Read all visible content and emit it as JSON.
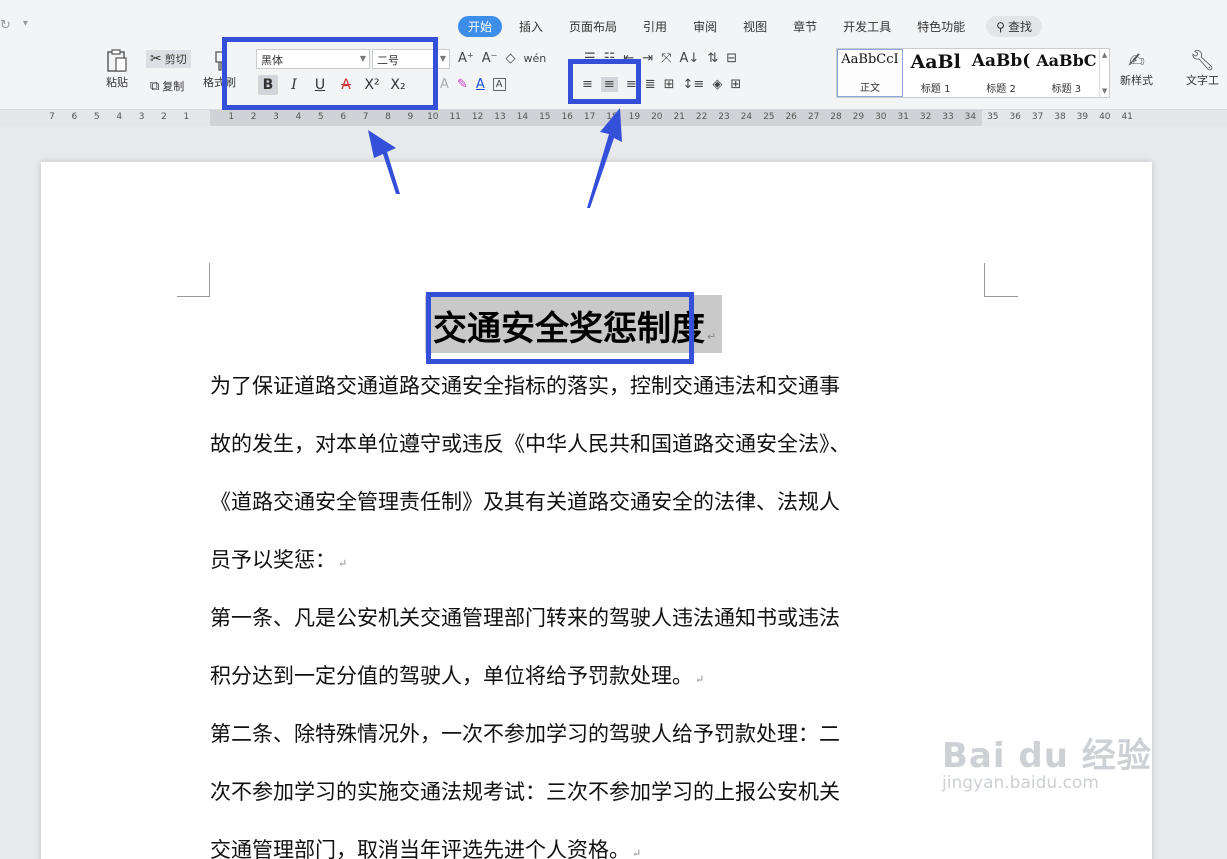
{
  "tabs": [
    "开始",
    "插入",
    "页面布局",
    "引用",
    "审阅",
    "视图",
    "章节",
    "开发工具",
    "特色功能"
  ],
  "search_label": "查找",
  "clipboard": {
    "paste_label": "粘贴",
    "cut_label": "剪切",
    "copy_label": "复制",
    "format_painter_label": "格式刷"
  },
  "font": {
    "family": "黑体",
    "size": "二号"
  },
  "styles": [
    {
      "sample": "AaBbCcI",
      "label": "正文"
    },
    {
      "sample": "AaBl",
      "label": "标题 1"
    },
    {
      "sample": "AaBb(",
      "label": "标题 2"
    },
    {
      "sample": "AaBbC",
      "label": "标题 3"
    }
  ],
  "new_style_label": "新样式",
  "text_tools_label": "文字工",
  "ruler_numbers": [
    "7",
    "6",
    "5",
    "4",
    "3",
    "2",
    "1",
    "",
    "1",
    "2",
    "3",
    "4",
    "5",
    "6",
    "7",
    "8",
    "9",
    "10",
    "11",
    "12",
    "13",
    "14",
    "15",
    "16",
    "17",
    "18",
    "19",
    "20",
    "21",
    "22",
    "23",
    "24",
    "25",
    "26",
    "27",
    "28",
    "29",
    "30",
    "31",
    "32",
    "33",
    "34",
    "35",
    "36",
    "37",
    "38",
    "39",
    "40",
    "41"
  ],
  "document": {
    "title": "交通安全奖惩制度",
    "lines": [
      "为了保证道路交通道路交通安全指标的落实，控制交通违法和交通事",
      "故的发生，对本单位遵守或违反《中华人民共和国道路交通安全法》、",
      "《道路交通安全管理责任制》及其有关道路交通安全的法律、法规人",
      "员予以奖惩：",
      "第一条、凡是公安机关交通管理部门转来的驾驶人违法通知书或违法",
      "积分达到一定分值的驾驶人，单位将给予罚款处理。",
      "第二条、除特殊情况外，一次不参加学习的驾驶人给予罚款处理：二",
      "次不参加学习的实施交通法规考试：三次不参加学习的上报公安机关",
      "交通管理部门，取消当年评选先进个人资格。"
    ],
    "para_end_lines": [
      3,
      5,
      8
    ]
  },
  "watermark": {
    "main": "Bai du 经验",
    "sub": "jingyan.baidu.com"
  },
  "colors": {
    "accent": "#3c8eea",
    "annotation": "#3450d8"
  }
}
